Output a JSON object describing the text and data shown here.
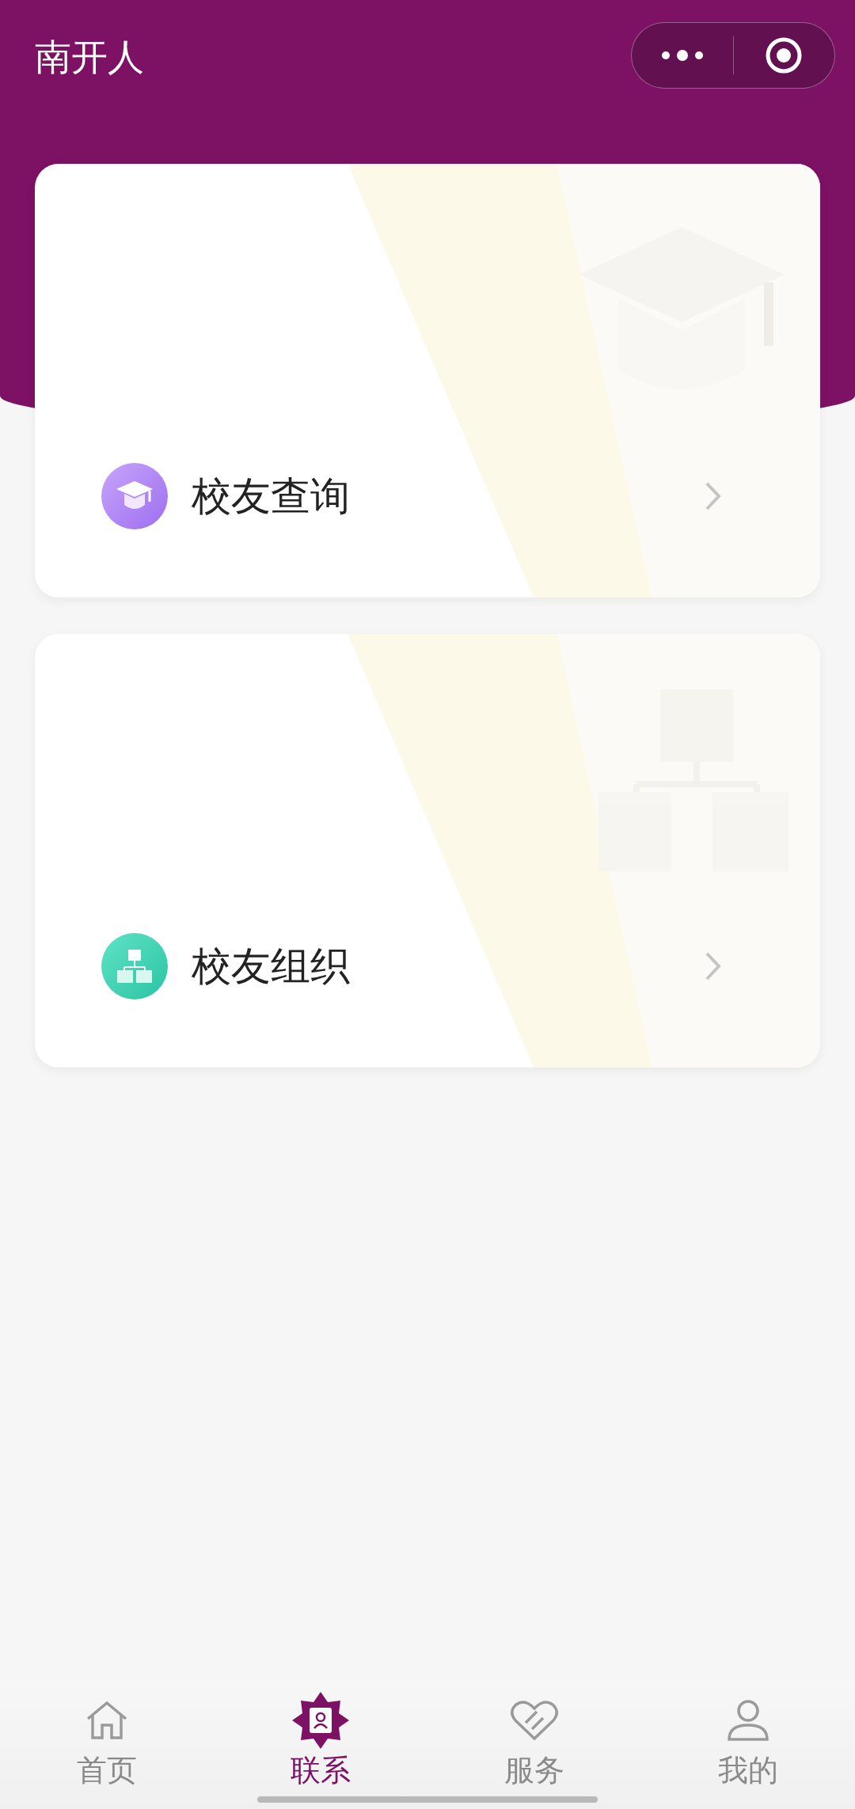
{
  "header": {
    "title": "南开人"
  },
  "cards": [
    {
      "label": "校友查询",
      "kind": "search"
    },
    {
      "label": "校友组织",
      "kind": "organization"
    }
  ],
  "tabs": [
    {
      "label": "首页",
      "kind": "home",
      "selected": false
    },
    {
      "label": "联系",
      "kind": "contacts",
      "selected": true
    },
    {
      "label": "服务",
      "kind": "service",
      "selected": false
    },
    {
      "label": "我的",
      "kind": "profile",
      "selected": false
    }
  ]
}
